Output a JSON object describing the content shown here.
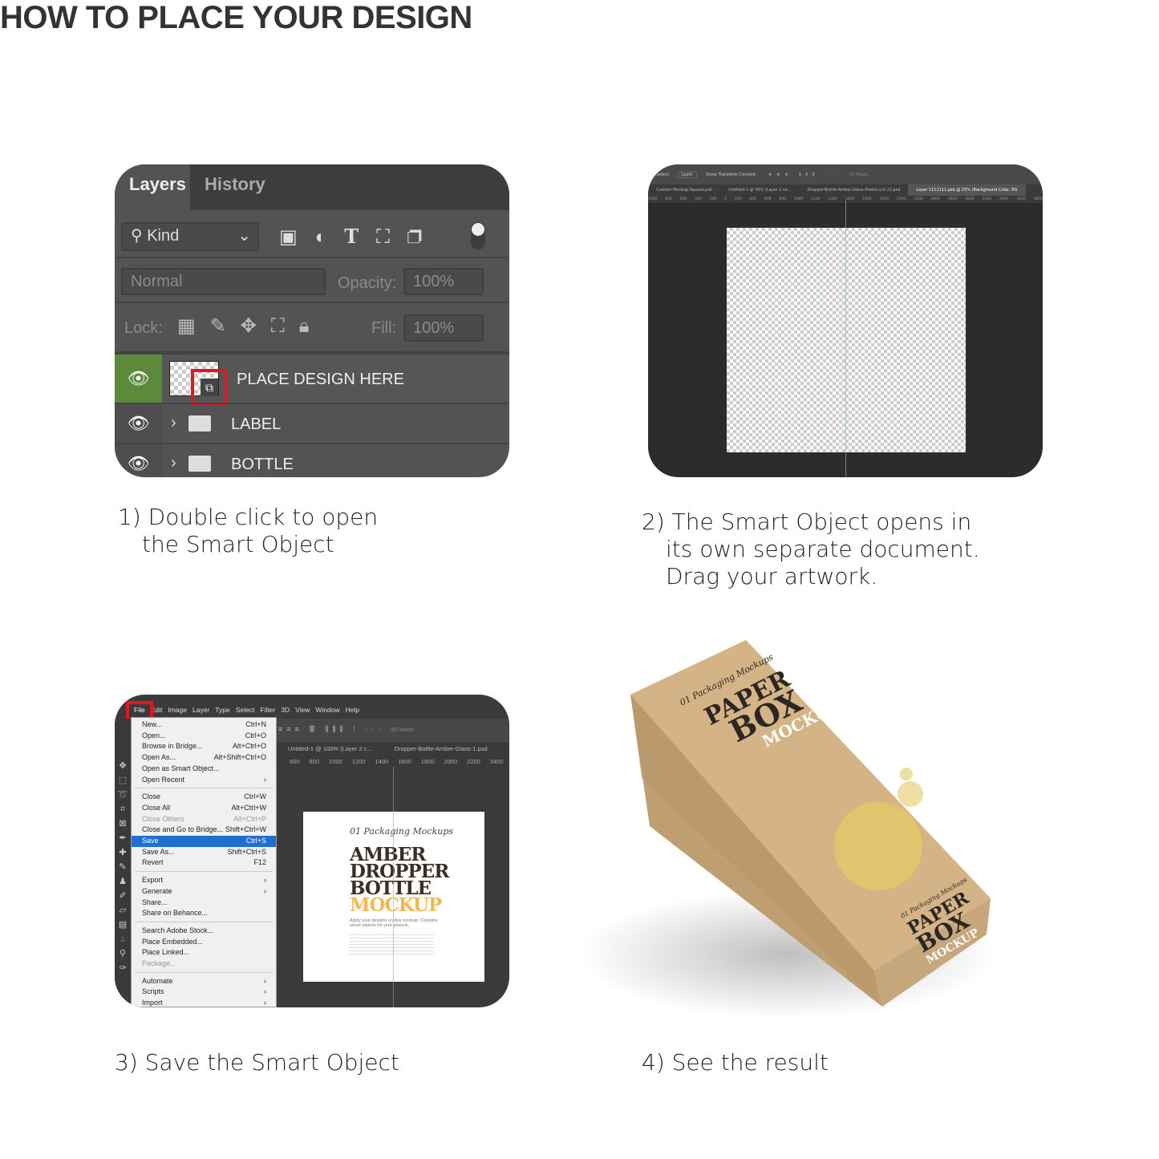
{
  "title": "HOW TO PLACE YOUR DESIGN",
  "steps": [
    {
      "line1": "1) Double click to open",
      "line2": "the Smart Object"
    },
    {
      "line1": "2) The Smart Object opens in",
      "line2": "its own separate document.",
      "line3": "Drag your artwork."
    },
    {
      "line1": "3) Save the Smart Object"
    },
    {
      "line1": "4) See the result"
    }
  ],
  "layers_panel": {
    "tabs": [
      "Layers",
      "History"
    ],
    "filter": "Kind",
    "blend_mode": "Normal",
    "opacity_label": "Opacity:",
    "opacity": "100%",
    "lock_label": "Lock:",
    "fill_label": "Fill:",
    "fill": "100%",
    "layers": [
      "PLACE DESIGN HERE",
      "LABEL",
      "BOTTLE"
    ],
    "accent": "#5b8a3a",
    "highlight": "#e3161b"
  },
  "smart_object_doc": {
    "options": {
      "select": "Select:",
      "layer": "Layer",
      "transform": "Show Transform Controls",
      "mode": "3D Mode:"
    },
    "tabs": [
      "Custom-Mockup-Square.psb",
      "Untitled-1 @ 50% (Layer 2 co...",
      "Dropper-Bottle-Amber-Glass-Plastic-Lid-11.psd",
      "Layer 1111111.psb @ 25% (Background Color, RG"
    ],
    "ruler": [
      "1000",
      "800",
      "600",
      "400",
      "200",
      "0",
      "200",
      "400",
      "600",
      "800",
      "1000",
      "1200",
      "1400",
      "1600",
      "1800",
      "2000",
      "2200",
      "2400",
      "2600",
      "2800",
      "3000",
      "3200",
      "3400",
      "3600",
      "3800"
    ]
  },
  "save_screen": {
    "menubar": [
      "File",
      "Edit",
      "Image",
      "Layer",
      "Type",
      "Select",
      "Filter",
      "3D",
      "View",
      "Window",
      "Help"
    ],
    "menu": [
      {
        "label": "New...",
        "shortcut": "Ctrl+N"
      },
      {
        "label": "Open...",
        "shortcut": "Ctrl+O"
      },
      {
        "label": "Browse in Bridge...",
        "shortcut": "Alt+Ctrl+O"
      },
      {
        "label": "Open As...",
        "shortcut": "Alt+Shift+Ctrl+O"
      },
      {
        "label": "Open as Smart Object...",
        "shortcut": ""
      },
      {
        "label": "Open Recent",
        "shortcut": "›"
      },
      {
        "sep": true
      },
      {
        "label": "Close",
        "shortcut": "Ctrl+W"
      },
      {
        "label": "Close All",
        "shortcut": "Alt+Ctrl+W"
      },
      {
        "label": "Close Others",
        "shortcut": "Alt+Ctrl+P",
        "disabled": true
      },
      {
        "label": "Close and Go to Bridge...",
        "shortcut": "Shift+Ctrl+W"
      },
      {
        "label": "Save",
        "shortcut": "Ctrl+S",
        "selected": true
      },
      {
        "label": "Save As...",
        "shortcut": "Shift+Ctrl+S"
      },
      {
        "label": "Revert",
        "shortcut": "F12"
      },
      {
        "sep": true
      },
      {
        "label": "Export",
        "shortcut": "›"
      },
      {
        "label": "Generate",
        "shortcut": "›"
      },
      {
        "label": "Share...",
        "shortcut": ""
      },
      {
        "label": "Share on Behance...",
        "shortcut": ""
      },
      {
        "sep": true
      },
      {
        "label": "Search Adobe Stock...",
        "shortcut": ""
      },
      {
        "label": "Place Embedded...",
        "shortcut": ""
      },
      {
        "label": "Place Linked...",
        "shortcut": ""
      },
      {
        "label": "Package...",
        "shortcut": "",
        "disabled": true
      },
      {
        "sep": true
      },
      {
        "label": "Automate",
        "shortcut": "›"
      },
      {
        "label": "Scripts",
        "shortcut": "›"
      },
      {
        "label": "Import",
        "shortcut": "›"
      }
    ],
    "doc_tabs": [
      "Untitled-1 @ 100% (Layer 2 c...",
      "Dropper-Bottle-Amber-Glass-1.psd"
    ],
    "mode": "3D Mode:",
    "ruler": [
      "600",
      "800",
      "1000",
      "1200",
      "1400",
      "1600",
      "1800",
      "2000",
      "2200",
      "2400"
    ],
    "artwork": {
      "script": "01 Packaging Mockups",
      "lines": [
        "AMBER",
        "DROPPER",
        "BOTTLE"
      ],
      "accent_line": "MOCKUP",
      "tagline": "Apply your designs on this mockup. Contains smart objects for your artwork.",
      "accent": "#f5b851",
      "dark": "#3a2f26"
    }
  },
  "result_box": {
    "script": "01 Packaging Mockups",
    "title": [
      "PAPER",
      "BOX",
      "MOCKUP"
    ],
    "kraft": "#c9a67a"
  }
}
